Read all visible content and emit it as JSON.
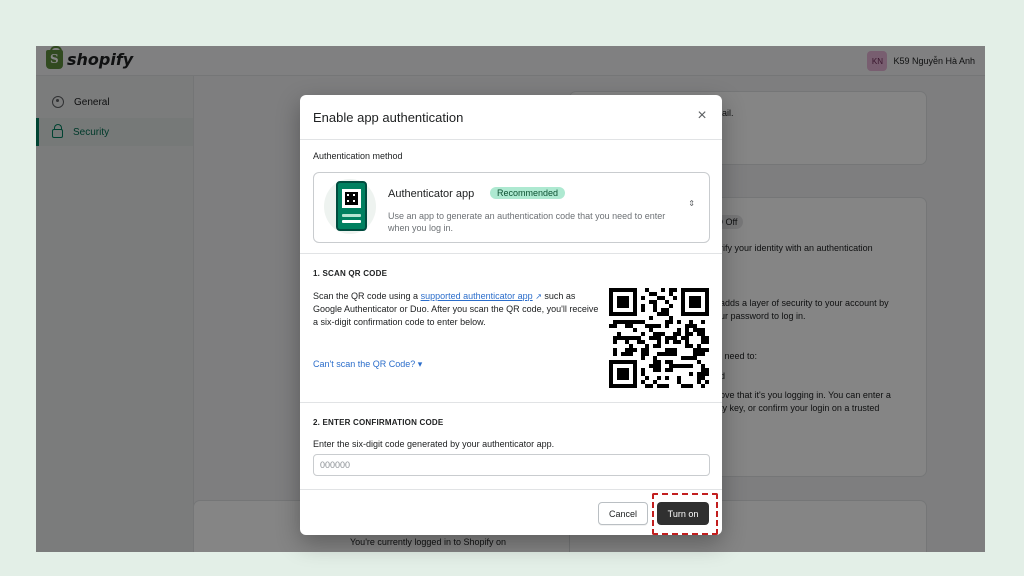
{
  "app": {
    "brand": "shopify"
  },
  "user": {
    "initials": "KN",
    "name": "K59 Nguyễn Hà Anh"
  },
  "sidebar": {
    "items": [
      {
        "label": "General",
        "active": false
      },
      {
        "label": "Security",
        "active": true
      }
    ]
  },
  "background": {
    "text_email_fragment": "ail.",
    "status_badge": "O Off",
    "verify_fragment": "rify your identity with an authentication",
    "layer_line1": "adds a layer of security to your account by",
    "layer_line2": "ur password to log in.",
    "need_to": "l need to:",
    "d_fragment": "d",
    "prove_line1": "ove that it's you logging in. You can enter a",
    "prove_line2": "ty key, or confirm your login on a trusted",
    "logged_in": "You're currently logged in to Shopify on"
  },
  "modal": {
    "title": "Enable app authentication",
    "close_icon": "×",
    "auth_method_label": "Authentication method",
    "method": {
      "name": "Authenticator app",
      "badge": "Recommended",
      "description": "Use an app to generate an authentication code that you need to enter when you log in.",
      "arrows": "⇕"
    },
    "scan": {
      "title": "1. SCAN QR CODE",
      "text_before": "Scan the QR code using a ",
      "link": "supported authenticator app",
      "ext_icon": "↗",
      "text_after": " such as Google Authenticator or Duo. After you scan the QR code, you'll receive a six-digit confirmation code to enter below.",
      "cant_scan": "Can't scan the QR Code? ▾"
    },
    "confirm": {
      "title": "2. ENTER CONFIRMATION CODE",
      "instruction": "Enter the six-digit code generated by your authenticator app.",
      "value": "",
      "placeholder": "000000"
    },
    "footer": {
      "cancel_label": "Cancel",
      "turn_on_label": "Turn on"
    }
  },
  "colors": {
    "accent": "#008060",
    "primary_button": "#303030",
    "link": "#2c6ecb",
    "highlight": "#c21f1f",
    "badge_recommended": "#aee9d1"
  }
}
